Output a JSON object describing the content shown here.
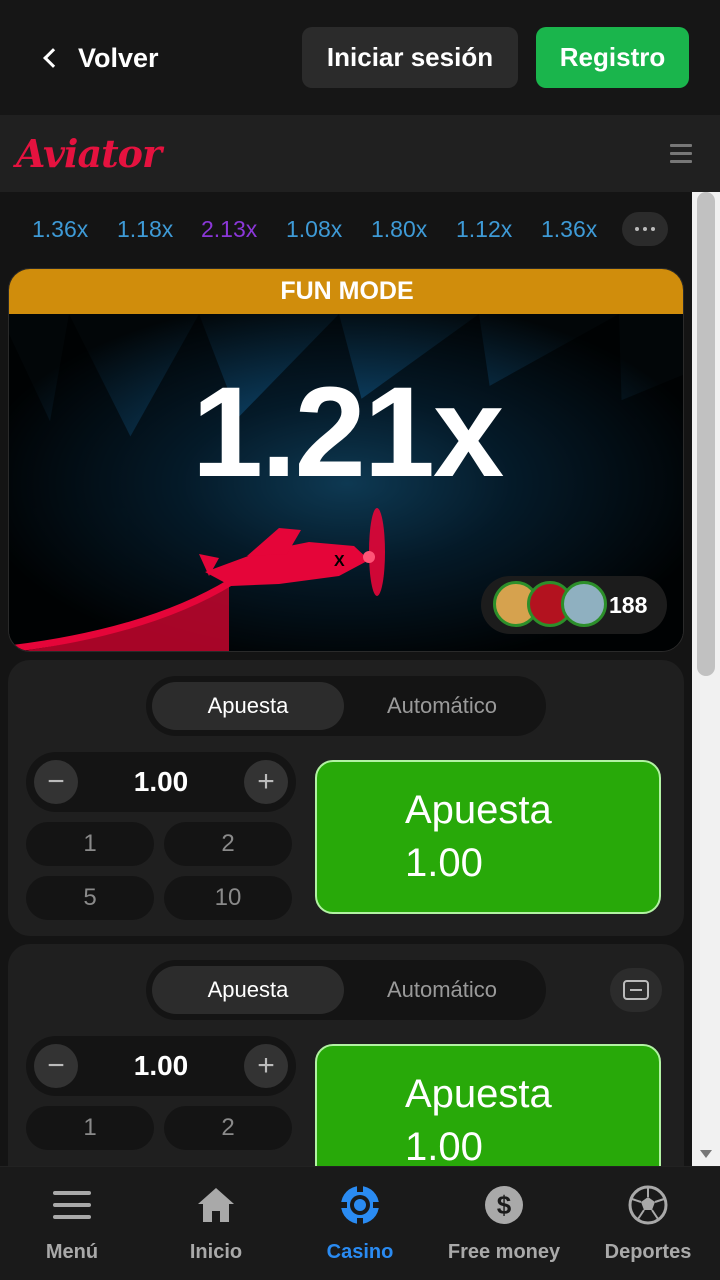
{
  "topbar": {
    "back_label": "Volver",
    "login_label": "Iniciar sesión",
    "register_label": "Registro",
    "register_color": "#1ab54c"
  },
  "game_header": {
    "logo_text": "Aviator",
    "logo_color": "#e5123f",
    "menu_icon": "hamburger-icon"
  },
  "history": {
    "multipliers": [
      "1.36x",
      "1.18x",
      "2.13x",
      "1.08x",
      "1.80x",
      "1.12x",
      "1.36x"
    ],
    "more_icon": "more-dots-icon"
  },
  "stage": {
    "mode_banner": "FUN MODE",
    "multiplier": "1.21x",
    "player_count": "188",
    "plane_color": "#e50539"
  },
  "panels": [
    {
      "tab_bet": "Apuesta",
      "tab_auto": "Automático",
      "amount": "1.00",
      "quick_values": [
        "1",
        "2",
        "5",
        "10"
      ],
      "bet_label": "Apuesta",
      "bet_amount": "1.00"
    },
    {
      "tab_bet": "Apuesta",
      "tab_auto": "Automático",
      "amount": "1.00",
      "quick_values": [
        "1",
        "2"
      ],
      "bet_label": "Apuesta",
      "bet_amount": "1.00"
    }
  ],
  "bottom_nav": [
    {
      "label": "Menú",
      "icon": "menu-icon",
      "active": false
    },
    {
      "label": "Inicio",
      "icon": "home-icon",
      "active": false
    },
    {
      "label": "Casino",
      "icon": "casino-chip-icon",
      "active": true
    },
    {
      "label": "Free money",
      "icon": "dollar-coin-icon",
      "active": false
    },
    {
      "label": "Deportes",
      "icon": "soccer-ball-icon",
      "active": false
    }
  ],
  "colors": {
    "bet_green": "#28a909",
    "accent_blue": "#2a8bf2",
    "history_blue": "#3e9ad6",
    "history_purple": "#8b37d8",
    "banner_orange": "#d08d0c"
  }
}
